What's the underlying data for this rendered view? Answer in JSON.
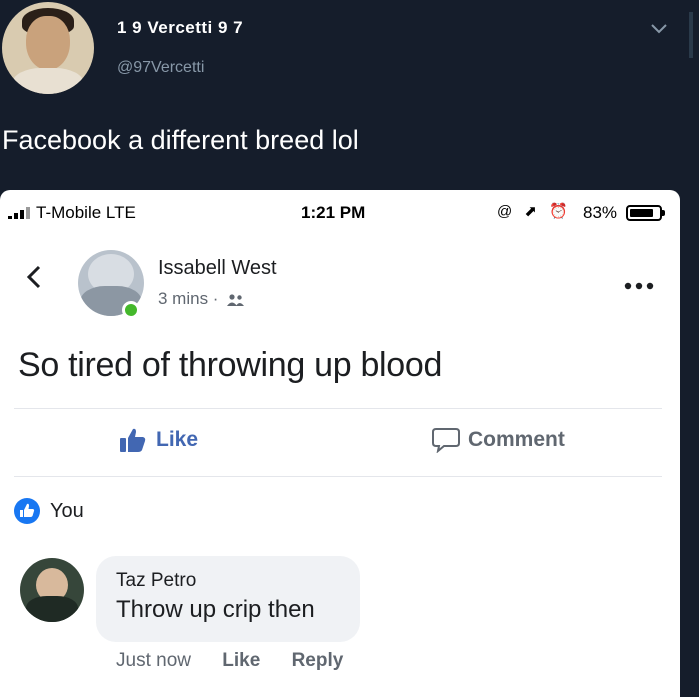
{
  "tweet": {
    "display_name": "1 9 Vercetti 9 7",
    "handle": "@97Vercetti",
    "text": "Facebook a different breed lol",
    "menu_icon": "chevron-down-icon"
  },
  "screenshot": {
    "status_bar": {
      "carrier": "T-Mobile  LTE",
      "time": "1:21 PM",
      "icons": "@ ⬈ ⏰",
      "battery_percent": "83%",
      "battery_level": 0.83
    },
    "post": {
      "author": "Issabell West",
      "meta": "3 mins ·",
      "audience_icon": "friends-icon",
      "text": "So tired of throwing up blood",
      "author_online": true
    },
    "actions": {
      "like_label": "Like",
      "comment_label": "Comment"
    },
    "reaction": {
      "label": "You"
    },
    "comment": {
      "author": "Taz Petro",
      "text": "Throw up crip then",
      "time": "Just now",
      "like_label": "Like",
      "reply_label": "Reply"
    },
    "colors": {
      "facebook_blue": "#4267b2",
      "online_green": "#44b82b",
      "twitter_bg": "#151d2b"
    }
  }
}
